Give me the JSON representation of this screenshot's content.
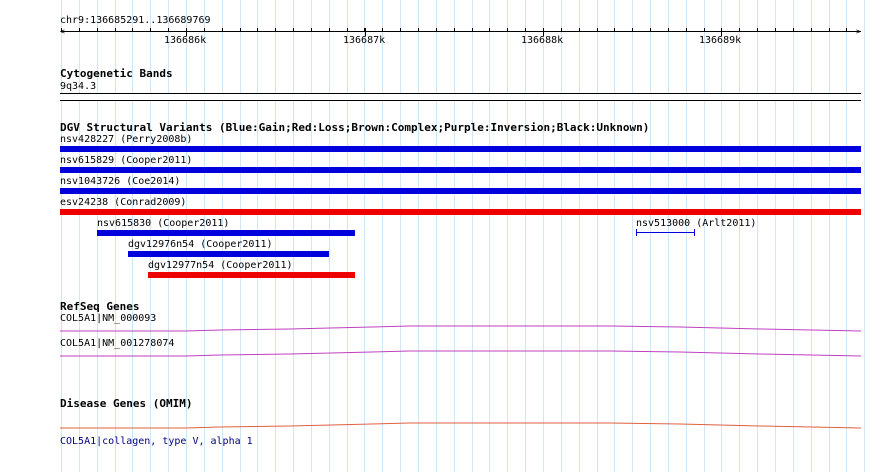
{
  "browser": {
    "location": "chr9:136685291..136689769",
    "ruler_ticks": [
      "136686k",
      "136687k",
      "136688k",
      "136689k"
    ],
    "cytoband": {
      "title": "Cytogenetic Bands",
      "band": "9q34.3"
    },
    "dgv": {
      "title": "DGV Structural Variants (Blue:Gain;Red:Loss;Brown:Complex;Purple:Inversion;Black:Unknown)",
      "variants": [
        {
          "label": "nsv428227 (Perry2008b)",
          "type": "Gain",
          "color": "#0000dd"
        },
        {
          "label": "nsv615829 (Cooper2011)",
          "type": "Gain",
          "color": "#0000dd"
        },
        {
          "label": "nsv1043726 (Coe2014)",
          "type": "Gain",
          "color": "#0000dd"
        },
        {
          "label": "esv24238 (Conrad2009)",
          "type": "Loss",
          "color": "#ee0000"
        },
        {
          "label": "nsv615830 (Cooper2011)",
          "type": "Gain",
          "color": "#0000dd"
        },
        {
          "label": "nsv513000 (Arlt2011)",
          "type": "Gain",
          "color": "#0000dd"
        },
        {
          "label": "dgv12976n54 (Cooper2011)",
          "type": "Gain",
          "color": "#0000dd"
        },
        {
          "label": "dgv12977n54 (Cooper2011)",
          "type": "Loss",
          "color": "#ee0000"
        }
      ]
    },
    "refseq": {
      "title": "RefSeq Genes",
      "genes": [
        {
          "label": "COL5A1|NM_000093",
          "color": "#c040c0"
        },
        {
          "label": "COL5A1|NM_001278074",
          "color": "#c040c0"
        }
      ]
    },
    "omim": {
      "title": "Disease Genes (OMIM)",
      "gene": {
        "label": "COL5A1|collagen, type V, alpha 1",
        "color": "#e06040",
        "label_color": "#000080"
      }
    }
  }
}
